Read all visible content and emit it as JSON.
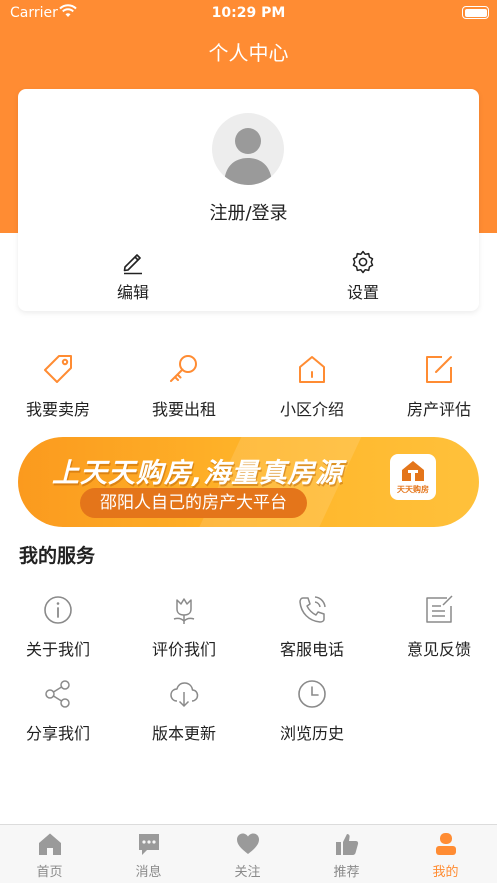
{
  "status_bar": {
    "carrier": "Carrier",
    "time": "10:29 PM"
  },
  "header": {
    "title": "个人中心"
  },
  "profile": {
    "login_label": "注册/登录",
    "actions": [
      {
        "icon": "pencil-icon",
        "label": "编辑"
      },
      {
        "icon": "gear-icon",
        "label": "设置"
      }
    ]
  },
  "quick_actions": [
    {
      "icon": "tag-icon",
      "label": "我要卖房"
    },
    {
      "icon": "key-icon",
      "label": "我要出租"
    },
    {
      "icon": "house-icon",
      "label": "小区介绍"
    },
    {
      "icon": "edit-square-icon",
      "label": "房产评估"
    }
  ],
  "banner": {
    "headline": "上天天购房,海量真房源",
    "subline": "邵阳人自己的房产大平台",
    "logo_text": "天天购房"
  },
  "services": {
    "title": "我的服务",
    "items": [
      {
        "icon": "info-icon",
        "label": "关于我们"
      },
      {
        "icon": "flower-icon",
        "label": "评价我们"
      },
      {
        "icon": "phone-icon",
        "label": "客服电话"
      },
      {
        "icon": "feedback-icon",
        "label": "意见反馈"
      },
      {
        "icon": "share-icon",
        "label": "分享我们"
      },
      {
        "icon": "download-icon",
        "label": "版本更新"
      },
      {
        "icon": "clock-icon",
        "label": "浏览历史"
      }
    ]
  },
  "tabbar": {
    "active_index": 4,
    "tabs": [
      {
        "icon": "home-icon",
        "label": "首页"
      },
      {
        "icon": "message-icon",
        "label": "消息"
      },
      {
        "icon": "heart-icon",
        "label": "关注"
      },
      {
        "icon": "thumbs-up-icon",
        "label": "推荐"
      },
      {
        "icon": "user-icon",
        "label": "我的"
      }
    ]
  },
  "colors": {
    "accent": "#ff8c33",
    "inactive": "#8a8a8a",
    "banner": "#ffb62a"
  }
}
